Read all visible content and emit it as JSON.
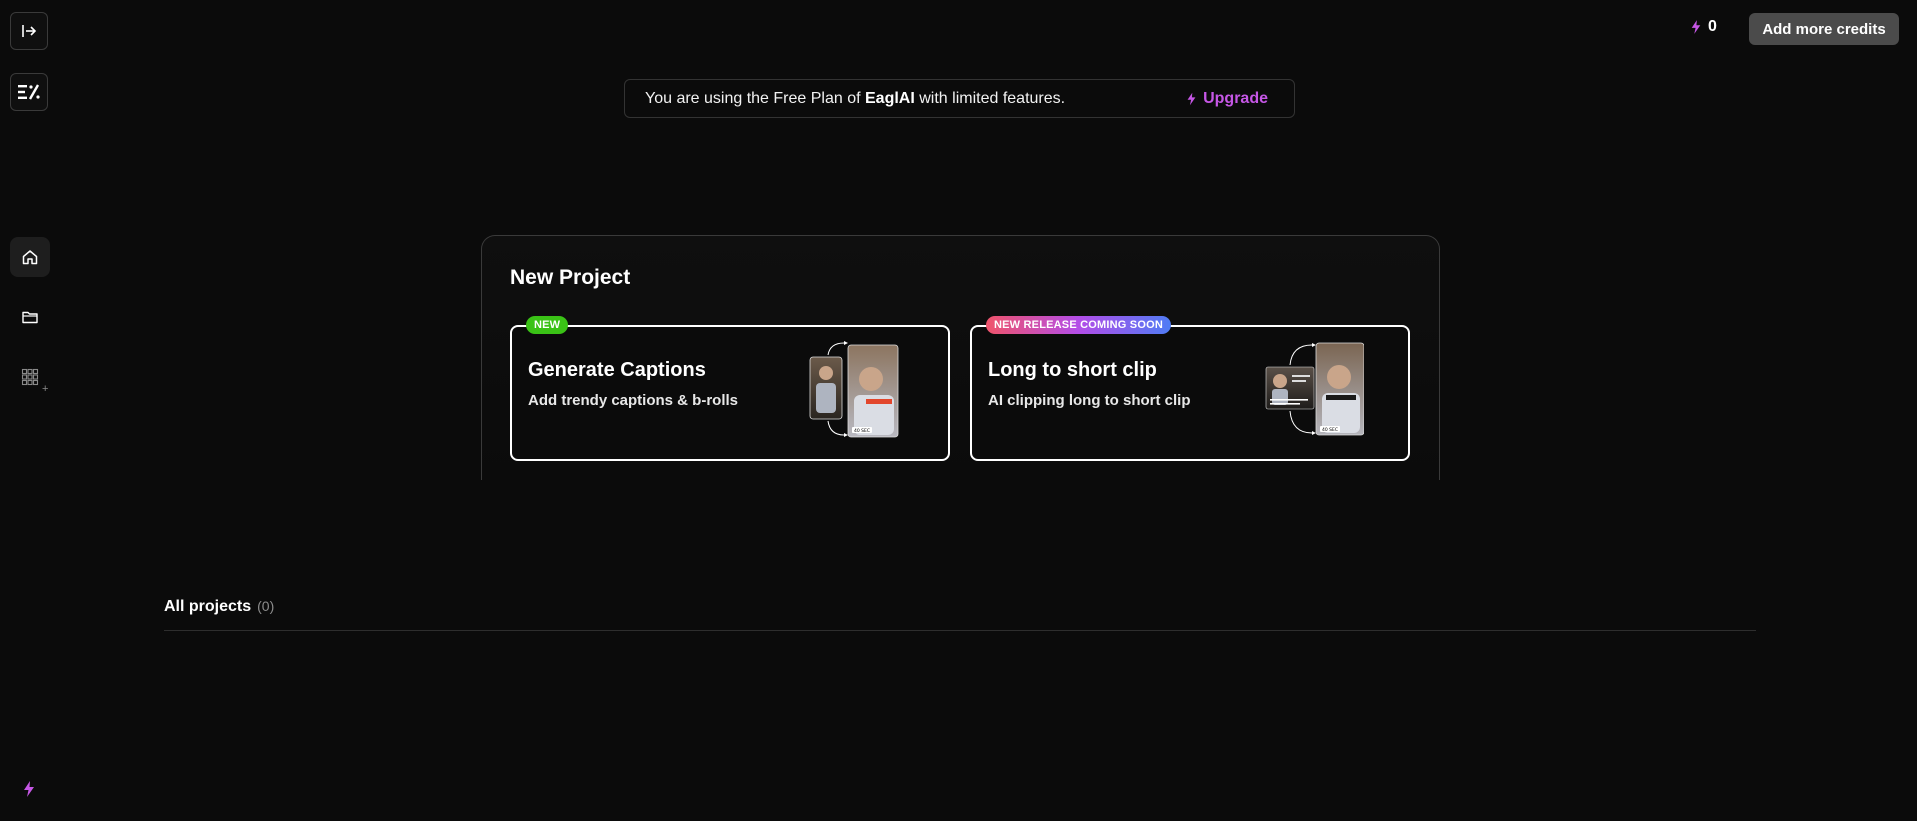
{
  "sidebar": {
    "collapse_icon": "sidebar-expand-icon",
    "logo_icon": "eagl-logo-icon",
    "nav": [
      {
        "id": "home",
        "icon": "home-icon",
        "active": true
      },
      {
        "id": "projects",
        "icon": "folder-icon",
        "active": false
      },
      {
        "id": "apps",
        "icon": "grid-plus-icon",
        "active": false
      }
    ],
    "plus_glyph": "+"
  },
  "topbar": {
    "credits_count": "0",
    "add_credits_label": "Add more credits"
  },
  "plan_banner": {
    "text_before": "You are using the Free Plan of ",
    "brand": "EaglAI",
    "text_after": " with limited features.",
    "upgrade_label": "Upgrade"
  },
  "new_project": {
    "title": "New Project",
    "cards": [
      {
        "badge": "NEW",
        "title": "Generate Captions",
        "subtitle": "Add trendy captions & b-rolls",
        "thumb_label": "40 SEC"
      },
      {
        "badge": "NEW RELEASE COMING SOON",
        "title": "Long to short clip",
        "subtitle": "AI clipping long to short clip",
        "thumb_label": "40 SEC"
      }
    ]
  },
  "projects": {
    "heading": "All projects",
    "count": "(0)"
  },
  "colors": {
    "background": "#0b0b0b",
    "accent_purple": "#c657e6",
    "badge_green": "#3ac216",
    "button_gray": "#4b4b4b"
  }
}
